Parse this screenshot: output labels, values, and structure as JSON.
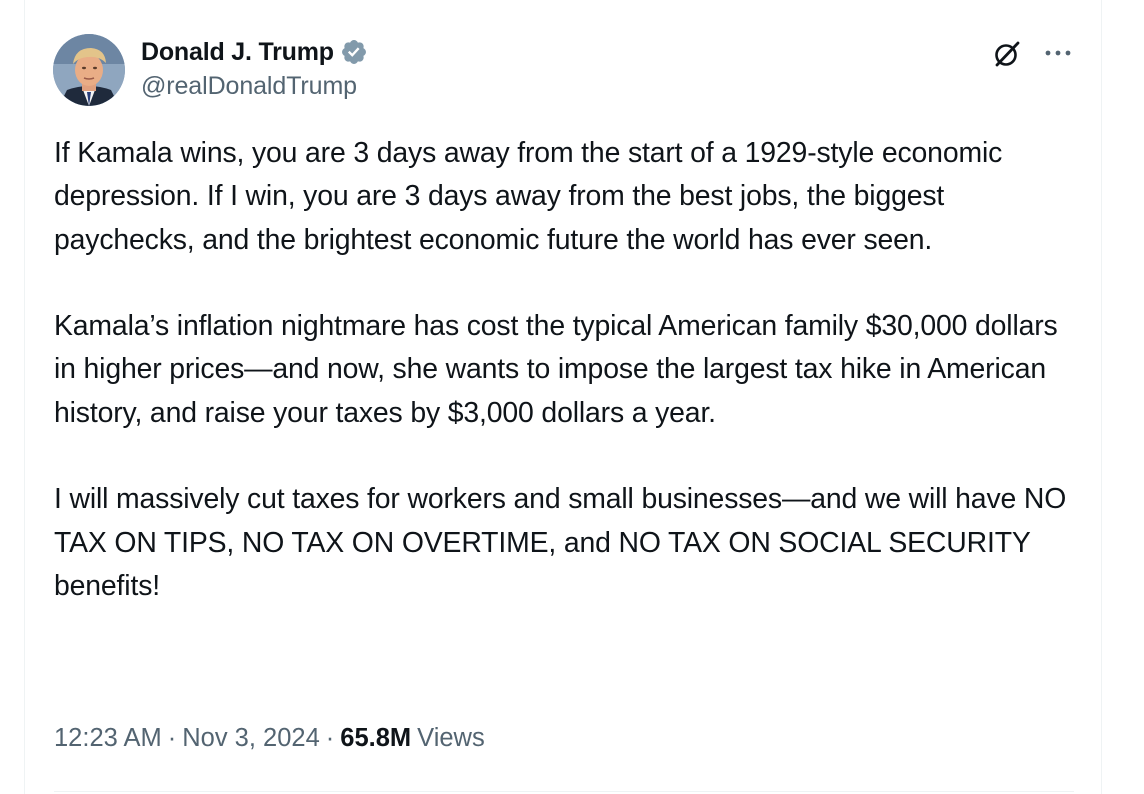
{
  "tweet": {
    "author": {
      "name": "Donald J. Trump",
      "handle": "@realDonaldTrump",
      "verified_badge_color": "#829aab",
      "avatar_icon": "profile-photo"
    },
    "paragraphs": [
      "If Kamala wins, you are 3 days away from the start of a 1929-style economic depression. If I win, you are 3 days away from the best jobs, the biggest paychecks, and the brightest economic future the world has ever seen.",
      "Kamala’s inflation nightmare has cost the typical American family $30,000 dollars in higher prices—and now, she wants to impose the largest tax hike in American history, and raise your taxes by $3,000 dollars a year.",
      "I will massively cut taxes for workers and small businesses—and we will have NO TAX ON TIPS, NO TAX ON OVERTIME, and NO TAX ON SOCIAL SECURITY benefits!"
    ],
    "meta": {
      "time": "12:23 AM",
      "separator": "·",
      "date": "Nov 3, 2024",
      "views_count": "65.8M",
      "views_label": "Views"
    },
    "icons": {
      "grok": "grok-icon",
      "more": "more-options-icon"
    }
  },
  "colors": {
    "text_primary": "#0f1419",
    "text_secondary": "#536471",
    "divider": "#eff3f4"
  }
}
